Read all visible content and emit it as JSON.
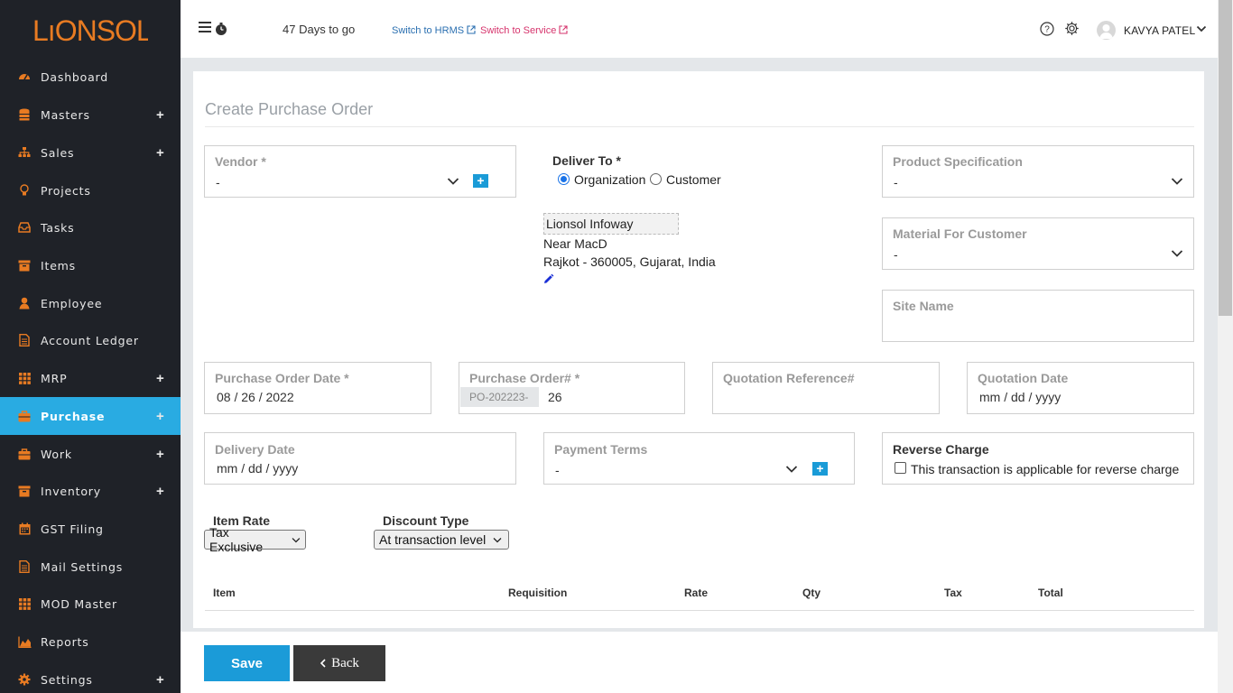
{
  "app": {
    "logo_text": "LIONSOL",
    "days_to_go": "47 Days to go",
    "switch_hrms": "Switch to HRMS",
    "switch_service": "Switch to Service",
    "user_name": "KAVYA PATEL"
  },
  "sidebar": {
    "items": [
      {
        "label": "Dashboard",
        "icon": "dashboard-icon",
        "has_plus": false,
        "active": false
      },
      {
        "label": "Masters",
        "icon": "database-icon",
        "has_plus": true,
        "active": false
      },
      {
        "label": "Sales",
        "icon": "sitemap-icon",
        "has_plus": true,
        "active": false
      },
      {
        "label": "Projects",
        "icon": "lightbulb-icon",
        "has_plus": false,
        "active": false
      },
      {
        "label": "Tasks",
        "icon": "inbox-icon",
        "has_plus": false,
        "active": false
      },
      {
        "label": "Items",
        "icon": "archive-icon",
        "has_plus": false,
        "active": false
      },
      {
        "label": "Employee",
        "icon": "user-icon",
        "has_plus": false,
        "active": false
      },
      {
        "label": "Account Ledger",
        "icon": "document-icon",
        "has_plus": false,
        "active": false
      },
      {
        "label": "MRP",
        "icon": "grid-icon",
        "has_plus": true,
        "active": false
      },
      {
        "label": "Purchase",
        "icon": "briefcase-icon",
        "has_plus": true,
        "active": true
      },
      {
        "label": "Work",
        "icon": "briefcase-icon",
        "has_plus": true,
        "active": false
      },
      {
        "label": "Inventory",
        "icon": "archive-icon",
        "has_plus": true,
        "active": false
      },
      {
        "label": "GST Filing",
        "icon": "calendar-icon",
        "has_plus": false,
        "active": false
      },
      {
        "label": "Mail Settings",
        "icon": "document-icon",
        "has_plus": false,
        "active": false
      },
      {
        "label": "MOD Master",
        "icon": "grid-icon",
        "has_plus": false,
        "active": false
      },
      {
        "label": "Reports",
        "icon": "area-chart-icon",
        "has_plus": false,
        "active": false
      },
      {
        "label": "Settings",
        "icon": "gear-icon",
        "has_plus": true,
        "active": false
      }
    ]
  },
  "form": {
    "title": "Create Purchase Order",
    "vendor": {
      "label": "Vendor *",
      "value": "-"
    },
    "deliver_to": {
      "label": "Deliver To *",
      "option_org": "Organization",
      "option_customer": "Customer",
      "selected": "Organization",
      "address_name": "Lionsol Infoway",
      "address_line1": "Near MacD",
      "address_line2": "Rajkot - 360005, Gujarat, India"
    },
    "product_spec": {
      "label": "Product Specification",
      "value": "-"
    },
    "material_for_customer": {
      "label": "Material For Customer",
      "value": "-"
    },
    "site_name": {
      "label": "Site Name",
      "value": ""
    },
    "po_date": {
      "label": "Purchase Order Date *",
      "value": "08 / 26 / 2022"
    },
    "po_number": {
      "label": "Purchase Order# *",
      "prefix": "PO-202223-",
      "value": "26"
    },
    "quotation_ref": {
      "label": "Quotation Reference#",
      "value": ""
    },
    "quotation_date": {
      "label": "Quotation Date",
      "value": "mm / dd / yyyy"
    },
    "delivery_date": {
      "label": "Delivery Date",
      "value": "mm / dd / yyyy"
    },
    "payment_terms": {
      "label": "Payment Terms",
      "value": "-"
    },
    "reverse_charge": {
      "label": "Reverse Charge",
      "checkbox_label": "This transaction is applicable for reverse charge",
      "checked": false
    },
    "item_rate": {
      "label": "Item Rate",
      "value": "Tax Exclusive"
    },
    "discount_type": {
      "label": "Discount Type",
      "value": "At transaction level"
    },
    "table_headers": [
      "Item",
      "Requisition",
      "Rate",
      "Qty",
      "Tax",
      "Total"
    ]
  },
  "actions": {
    "save": "Save",
    "back": "Back"
  },
  "colors": {
    "sidebar_bg": "#1f2228",
    "accent": "#29abe2",
    "icon_orange": "#e87b22"
  }
}
